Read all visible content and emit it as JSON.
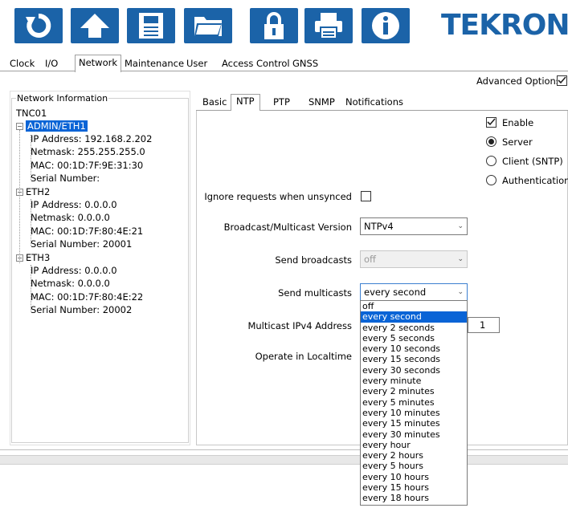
{
  "app": {
    "brand": "TEKRON"
  },
  "toolbar": {
    "buttons": [
      {
        "name": "refresh-button",
        "icon": "refresh-icon"
      },
      {
        "name": "upload-button",
        "icon": "upload-arrow-icon"
      },
      {
        "name": "save-button",
        "icon": "floppy-disk-icon"
      },
      {
        "name": "open-button",
        "icon": "folder-icon"
      },
      {
        "name": "lock-button",
        "icon": "lock-icon"
      },
      {
        "name": "print-button",
        "icon": "printer-icon"
      },
      {
        "name": "info-button",
        "icon": "info-icon"
      }
    ],
    "color": "#1b63a8"
  },
  "tabs": [
    "Clock",
    "I/O",
    "Network",
    "Maintenance",
    "User",
    "Access Control",
    "GNSS"
  ],
  "advanced_options": "Advanced Options",
  "network_info": {
    "title": "Network Information",
    "root": "TNC01",
    "eth1": {
      "name": "ADMIN/ETH1",
      "ip": "IP Address: 192.168.2.202",
      "mask": "Netmask: 255.255.255.0",
      "mac": "MAC: 00:1D:7F:9E:31:30",
      "serial": "Serial Number:"
    },
    "eth2": {
      "name": "ETH2",
      "ip": "IP Address: 0.0.0.0",
      "mask": "Netmask: 0.0.0.0",
      "mac": "MAC: 00:1D:7F:80:4E:21",
      "serial": "Serial Number: 20001"
    },
    "eth3": {
      "name": "ETH3",
      "ip": "IP Address: 0.0.0.0",
      "mask": "Netmask: 0.0.0.0",
      "mac": "MAC: 00:1D:7F:80:4E:22",
      "serial": "Serial Number: 20002"
    }
  },
  "inner_tabs": [
    "Basic",
    "NTP",
    "PTP",
    "SNMP",
    "Notifications"
  ],
  "ntp": {
    "enable": "Enable",
    "server": "Server",
    "client": "Client (SNTP)",
    "authentication": "Authentication",
    "ignore_label": "Ignore requests when unsynced",
    "version_label": "Broadcast/Multicast Version",
    "version_value": "NTPv4",
    "broadcasts_label": "Send broadcasts",
    "broadcasts_value": "off",
    "multicasts_label": "Send multicasts",
    "multicasts_value": "every second",
    "ipv4_label": "Multicast IPv4 Address",
    "ipv4_partial": "1",
    "localtime_label": "Operate in Localtime"
  },
  "dropdown_options": [
    "off",
    "every second",
    "every 2 seconds",
    "every 5 seconds",
    "every 10 seconds",
    "every 15 seconds",
    "every 30 seconds",
    "every minute",
    "every 2 minutes",
    "every 5 minutes",
    "every 10 minutes",
    "every 15 minutes",
    "every 30 minutes",
    "every hour",
    "every 2 hours",
    "every 5 hours",
    "every 10 hours",
    "every 15 hours",
    "every 18 hours"
  ],
  "dropdown_selected": "every second"
}
